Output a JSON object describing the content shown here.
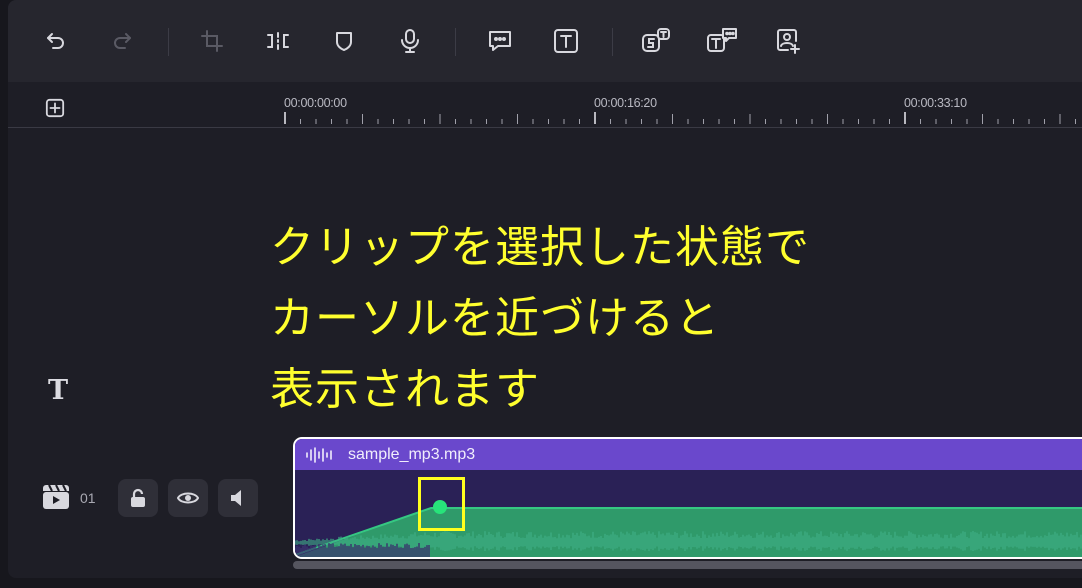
{
  "toolbar": {
    "buttons": [
      {
        "name": "undo-icon",
        "enabled": true
      },
      {
        "name": "redo-icon",
        "enabled": false
      },
      {
        "name": "crop-icon",
        "enabled": false
      },
      {
        "name": "split-icon",
        "enabled": true
      },
      {
        "name": "mask-icon",
        "enabled": true
      },
      {
        "name": "microphone-icon",
        "enabled": true
      },
      {
        "name": "speech-bubble-icon",
        "enabled": true
      },
      {
        "name": "text-icon",
        "enabled": true
      },
      {
        "name": "auto-subtitle-icon",
        "enabled": true
      },
      {
        "name": "text-to-speech-icon",
        "enabled": true
      },
      {
        "name": "ai-portrait-icon",
        "enabled": true
      }
    ]
  },
  "ruler": {
    "timecodes": [
      "00:00:00:00",
      "00:00:16:20",
      "00:00:33:10"
    ]
  },
  "tracks": {
    "text_track_icon": "T",
    "audio_track": {
      "number": "01",
      "clip_name": "sample_mp3.mp3"
    }
  },
  "annotation": {
    "lines": [
      "クリップを選択した状態で",
      "カーソルを近づけると",
      "表示されます"
    ],
    "color": "#ffff2e"
  },
  "colors": {
    "clip_header": "#6a48cc",
    "waveform": "#2f9a6a",
    "keyframe": "#27e37a",
    "highlight_box": "#ffff1e"
  }
}
